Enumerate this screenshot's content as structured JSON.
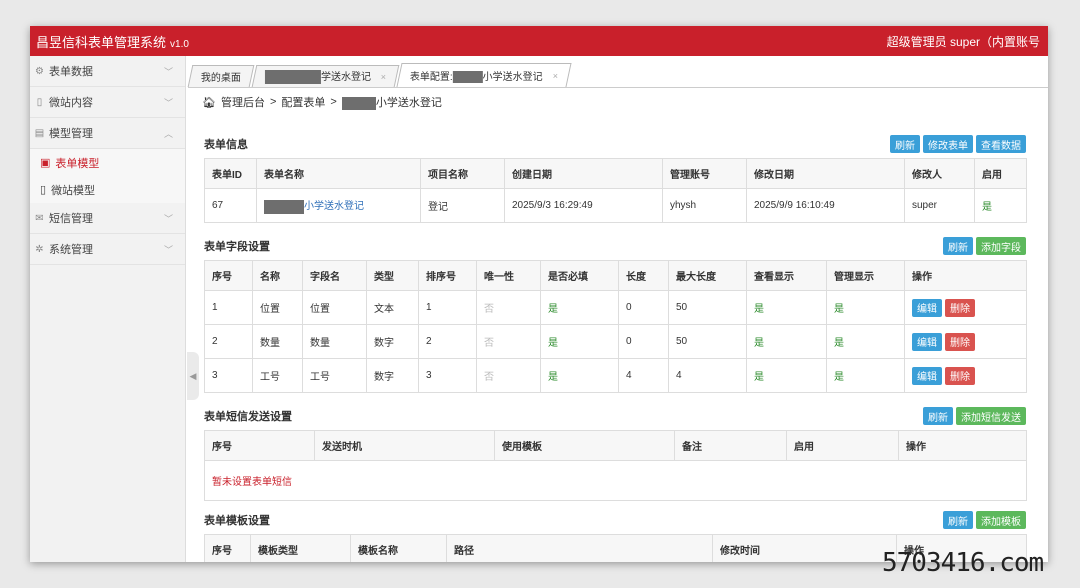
{
  "app": {
    "title": "昌昱信科表单管理系统",
    "version": "v1.0",
    "user": "超级管理员  super（内置账号"
  },
  "sidebar": {
    "items": [
      {
        "icon": "gear-icon",
        "label": "表单数据",
        "chevron": "﹀"
      },
      {
        "icon": "file-icon",
        "label": "微站内容",
        "chevron": "﹀"
      },
      {
        "icon": "list-icon",
        "label": "模型管理",
        "chevron": "︿"
      }
    ],
    "subitems": [
      {
        "icon": "form-icon",
        "label": "表单模型"
      },
      {
        "icon": "mobile-icon",
        "label": "微站模型"
      }
    ],
    "items2": [
      {
        "icon": "mail-icon",
        "label": "短信管理",
        "chevron": "﹀"
      },
      {
        "icon": "settings-icon",
        "label": "系统管理",
        "chevron": "﹀"
      }
    ]
  },
  "tabs": [
    {
      "label": "我的桌面"
    },
    {
      "label": "学送水登记",
      "close": "×"
    },
    {
      "label_prefix": "表单配置:",
      "label": "小学送水登记",
      "close": "×"
    }
  ],
  "breadcrumb": {
    "home": "管理后台",
    "sep": ">",
    "item1": "配置表单",
    "item2": "小学送水登记"
  },
  "form_info": {
    "title": "表单信息",
    "buttons": {
      "refresh": "刷新",
      "edit": "修改表单",
      "view": "查看数据"
    },
    "columns": [
      "表单ID",
      "表单名称",
      "项目名称",
      "创建日期",
      "管理账号",
      "修改日期",
      "修改人",
      "启用"
    ],
    "row": {
      "id": "67",
      "name": "小学送水登记",
      "project": "登记",
      "created": "2025/9/3 16:29:49",
      "account": "yhysh",
      "modified": "2025/9/9 16:10:49",
      "modifier": "super",
      "enabled": "是"
    }
  },
  "fields": {
    "title": "表单字段设置",
    "buttons": {
      "refresh": "刷新",
      "add": "添加字段"
    },
    "columns": [
      "序号",
      "名称",
      "字段名",
      "类型",
      "排序号",
      "唯一性",
      "是否必填",
      "长度",
      "最大长度",
      "查看显示",
      "管理显示",
      "操作"
    ],
    "rows": [
      {
        "no": "1",
        "name": "位置",
        "field": "位置",
        "type": "文本",
        "order": "1",
        "unique": "否",
        "required": "是",
        "len": "0",
        "maxlen": "50",
        "view": "是",
        "admin": "是"
      },
      {
        "no": "2",
        "name": "数量",
        "field": "数量",
        "type": "数字",
        "order": "2",
        "unique": "否",
        "required": "是",
        "len": "0",
        "maxlen": "50",
        "view": "是",
        "admin": "是"
      },
      {
        "no": "3",
        "name": "工号",
        "field": "工号",
        "type": "数字",
        "order": "3",
        "unique": "否",
        "required": "是",
        "len": "4",
        "maxlen": "4",
        "view": "是",
        "admin": "是"
      }
    ],
    "edit_label": "编辑",
    "delete_label": "删除"
  },
  "sms": {
    "title": "表单短信发送设置",
    "buttons": {
      "refresh": "刷新",
      "add": "添加短信发送"
    },
    "columns": [
      "序号",
      "发送时机",
      "使用模板",
      "备注",
      "启用",
      "操作"
    ],
    "empty": "暂未设置表单短信"
  },
  "templates": {
    "title": "表单模板设置",
    "buttons": {
      "refresh": "刷新",
      "add": "添加模板"
    },
    "columns": [
      "序号",
      "模板类型",
      "模板名称",
      "路径",
      "修改时间",
      "操作"
    ]
  },
  "watermark": "5703416.com",
  "colors": {
    "brand": "#c9202b",
    "button_blue": "#3a9fd8",
    "button_green": "#5cb85c",
    "button_red": "#d9534f",
    "yes": "#2a8a2a"
  }
}
